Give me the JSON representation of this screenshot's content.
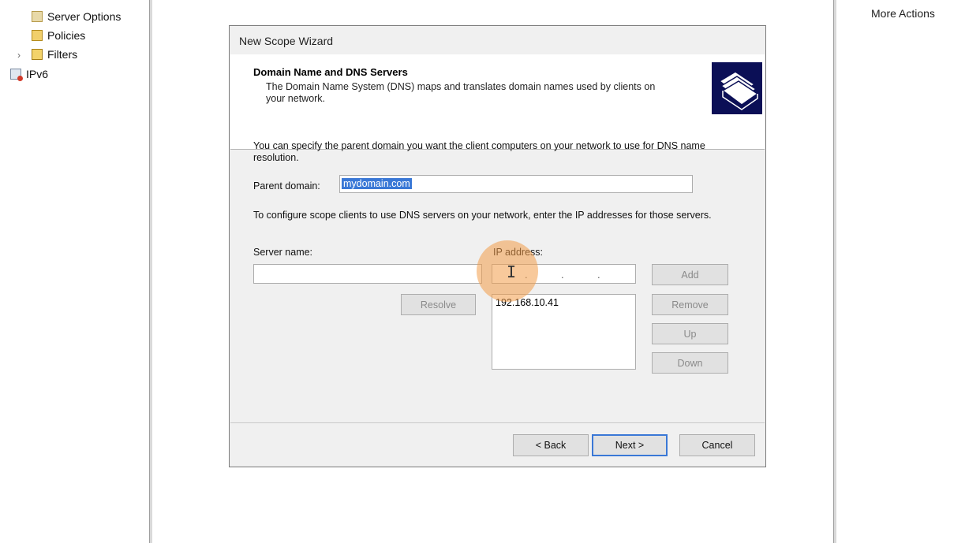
{
  "tree": {
    "items": [
      {
        "label": "Server Options",
        "icon": "server-options-icon"
      },
      {
        "label": "Policies",
        "icon": "policies-icon"
      },
      {
        "label": "Filters",
        "icon": "filters-icon"
      },
      {
        "label": "IPv6",
        "icon": "ipv6-icon"
      }
    ]
  },
  "actions": {
    "more_actions": "More Actions"
  },
  "wizard": {
    "window_title": "New Scope Wizard",
    "header_title": "Domain Name and DNS Servers",
    "header_desc": "The Domain Name System (DNS) maps and translates domain names used by clients on your network.",
    "intro_text": "You can specify the parent domain you want the client computers on your network to use for DNS name resolution.",
    "parent_domain_label": "Parent domain:",
    "parent_domain_value": "mydomain.com",
    "dns_text": "To configure scope clients to use DNS servers on your network, enter the IP addresses for those servers.",
    "server_name_label": "Server name:",
    "server_name_value": "",
    "ip_label": "IP address:",
    "ip_list": [
      "192.168.10.41"
    ],
    "buttons": {
      "resolve": "Resolve",
      "add": "Add",
      "remove": "Remove",
      "up": "Up",
      "down": "Down",
      "back": "< Back",
      "next": "Next >",
      "cancel": "Cancel"
    }
  },
  "colors": {
    "selection": "#3a78d6",
    "header_image_bg": "#0b0f56",
    "cursor_highlight": "#f39c49"
  }
}
